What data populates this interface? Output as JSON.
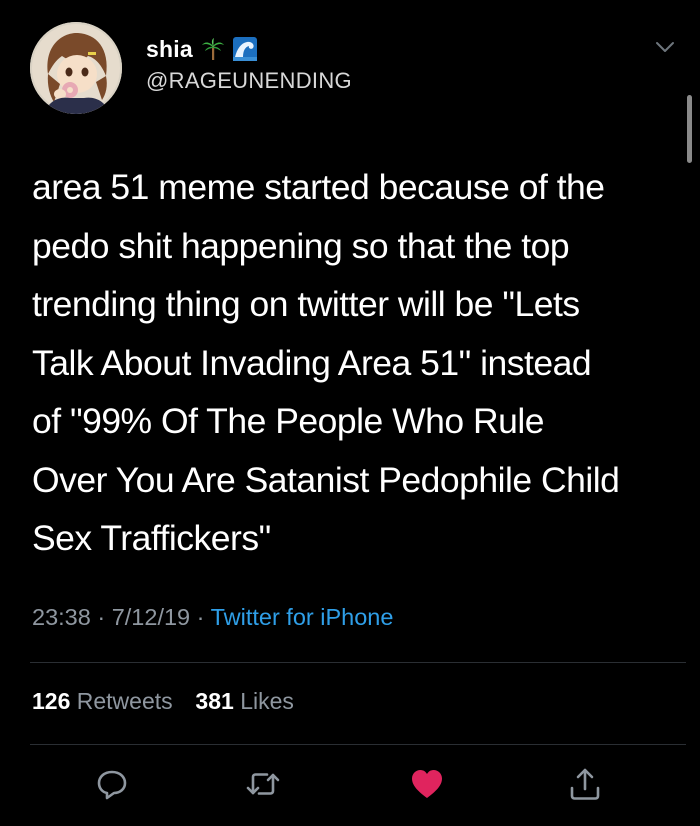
{
  "tweet": {
    "author": {
      "display_name": "shia",
      "emoji_icons": [
        "palm-tree-icon",
        "wave-icon"
      ],
      "handle": "@RAGEUNENDING"
    },
    "text": "area 51 meme started because of the\npedo shit happening so that the top\ntrending thing on twitter will be \"Lets\nTalk About Invading Area 51\" instead\nof \"99% Of The People Who Rule\nOver You Are Satanist Pedophile Child\nSex Traffickers\"",
    "time": "23:38",
    "date": "7/12/19",
    "separator": "·",
    "source": "Twitter for iPhone",
    "retweets_count": "126",
    "retweets_label": "Retweets",
    "likes_count": "381",
    "likes_label": "Likes",
    "liked": true
  },
  "colors": {
    "background": "#000000",
    "text": "#ffffff",
    "secondary": "#8f97a0",
    "accent": "#2f9fe8",
    "like": "#e0245e"
  },
  "icons": {
    "header": "chevron-down-icon",
    "actions": [
      "reply-icon",
      "retweet-icon",
      "like-heart-icon",
      "share-icon"
    ]
  }
}
